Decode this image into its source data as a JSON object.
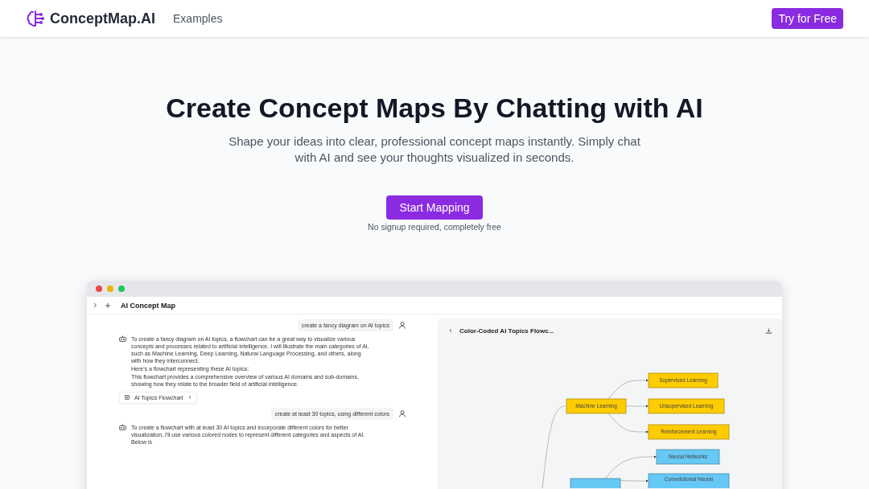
{
  "nav": {
    "brand": "ConceptMap.AI",
    "links": [
      "Examples"
    ],
    "cta": "Try for Free"
  },
  "hero": {
    "title": "Create Concept Maps By Chatting with AI",
    "subtitle": "Shape your ideas into clear, professional concept maps instantly. Simply chat with AI and see your thoughts visualized in seconds.",
    "button": "Start Mapping",
    "note": "No signup required, completely free"
  },
  "demo": {
    "title": "AI Concept Map",
    "messages": [
      {
        "kind": "user",
        "text": "create a fancy diagram on AI topics"
      },
      {
        "kind": "assistant",
        "paragraphs": [
          "To create a fancy diagram on AI topics, a flowchart can be a great way to visualize various concepts and processes related to artificial intelligence. I will illustrate the main categories of AI, such as Machine Learning, Deep Learning, Natural Language Processing, and others, along with how they interconnect.",
          "Here's a flowchart representing these AI topics:",
          "This flowchart provides a comprehensive overview of various AI domains and sub-domains, showing how they relate to the broader field of artificial intelligence."
        ],
        "attachment": "AI Topics Flowchart"
      },
      {
        "kind": "user",
        "text": "create at least 30 topics, using different colors"
      },
      {
        "kind": "assistant",
        "paragraphs": [
          "To create a flowchart with at least 30 AI topics and incorporate different colors for better visualization, I'll use various colored nodes to represent different categories and aspects of AI. Below is"
        ]
      }
    ],
    "preview": {
      "title": "Color-Coded AI Topics Flowc...",
      "nodes": [
        {
          "label": "Machine Learning",
          "color": "#ffcc00"
        },
        {
          "label": "Supervised Learning",
          "color": "#ffcc00"
        },
        {
          "label": "Unsupervised Learning",
          "color": "#ffcc00"
        },
        {
          "label": "Reinforcement Learning",
          "color": "#ffcc00"
        },
        {
          "label": "Neural Networks",
          "color": "#66c8f5"
        },
        {
          "label": "Convolutional Neural",
          "color": "#66c8f5"
        },
        {
          "color": "#66c8f5"
        }
      ]
    }
  }
}
